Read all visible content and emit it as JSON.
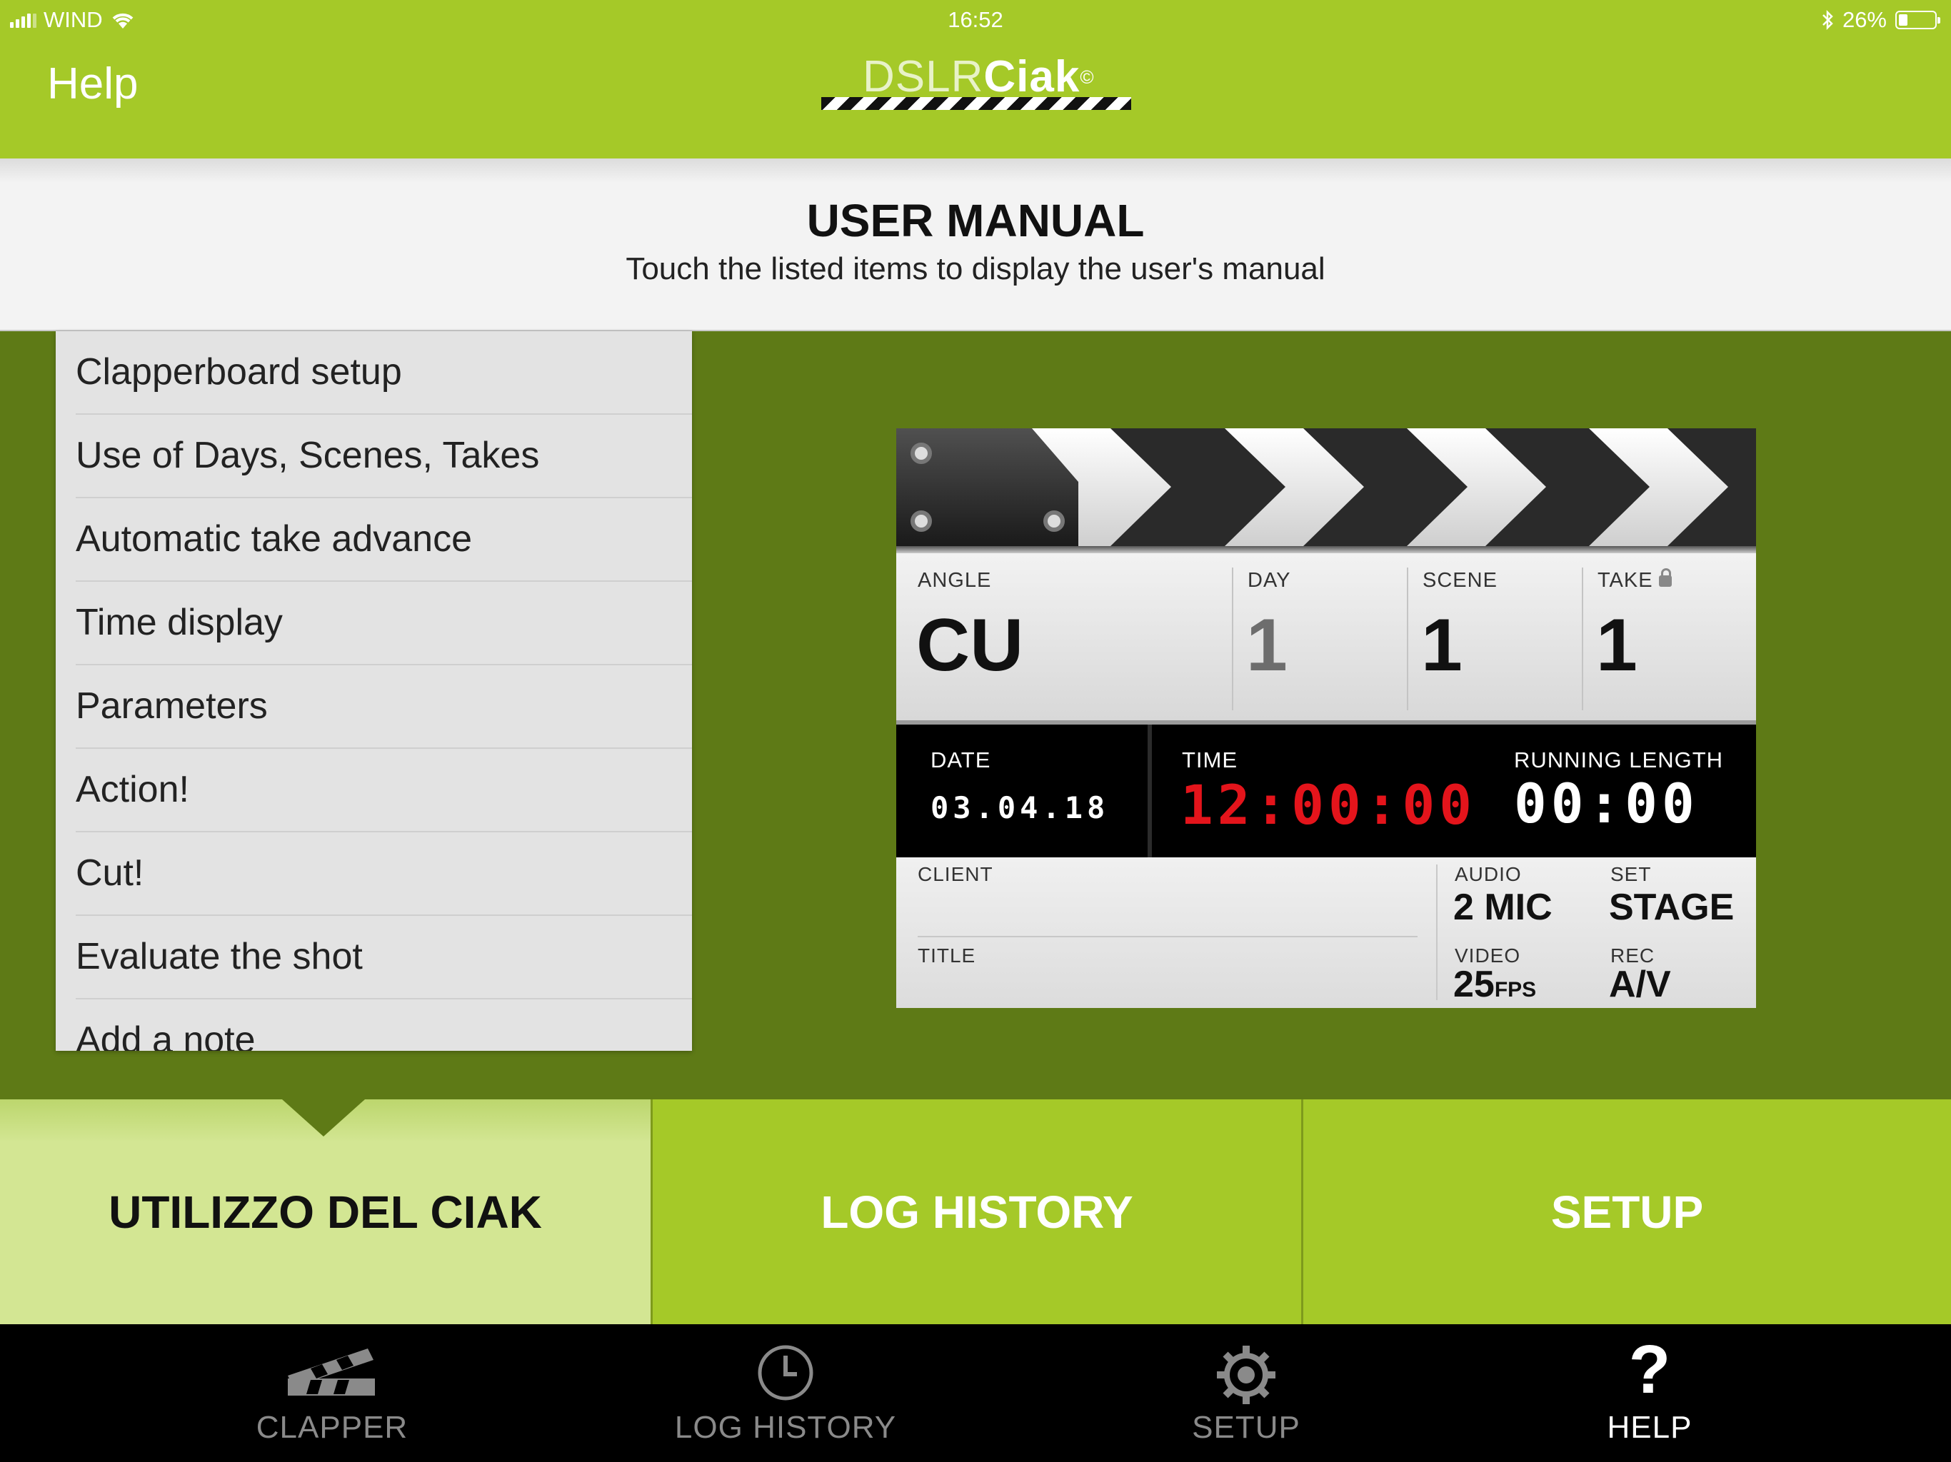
{
  "status_bar": {
    "carrier": "WIND",
    "time": "16:52",
    "battery": "26%",
    "battery_level": 0.26
  },
  "nav": {
    "back_title": "Help",
    "logo": {
      "light": "DSLR",
      "bold": "Ciak",
      "mark": "©"
    }
  },
  "header": {
    "title": "USER MANUAL",
    "subtitle": "Touch the listed items to display the user's manual"
  },
  "manual_items": [
    "Clapperboard setup",
    "Use of Days, Scenes, Takes",
    "Automatic take advance",
    "Time display",
    "Parameters",
    "Action!",
    "Cut!",
    "Evaluate the shot",
    "Add a note"
  ],
  "clapper": {
    "angle_label": "ANGLE",
    "angle_value": "CU",
    "day_label": "DAY",
    "day_value": "1",
    "scene_label": "SCENE",
    "scene_value": "1",
    "take_label": "TAKE",
    "take_value": "1",
    "date_label": "DATE",
    "date_value": "03.04.18",
    "time_label": "TIME",
    "time_value": "12:00:00",
    "running_label": "RUNNING LENGTH",
    "running_value": "00:00",
    "client_label": "CLIENT",
    "title_label": "TITLE",
    "audio_label": "AUDIO",
    "audio_value": "2 MIC",
    "set_label": "SET",
    "set_value": "STAGE",
    "video_label": "VIDEO",
    "video_value": "25",
    "video_unit": "FPS",
    "rec_label": "REC",
    "rec_value": "A/V",
    "colors": {
      "time": "#e4141b",
      "running": "#ffffff",
      "date": "#ffffff"
    }
  },
  "segments": [
    {
      "label": "UTILIZZO DEL CIAK",
      "active": true
    },
    {
      "label": "LOG HISTORY",
      "active": false
    },
    {
      "label": "SETUP",
      "active": false
    }
  ],
  "tabbar": [
    {
      "label": "CLAPPER",
      "icon": "clapper-icon",
      "active": false
    },
    {
      "label": "LOG HISTORY",
      "icon": "clock-icon",
      "active": false
    },
    {
      "label": "SETUP",
      "icon": "gear-icon",
      "active": false
    },
    {
      "label": "HELP",
      "icon": "question-icon",
      "active": true
    }
  ],
  "colors": {
    "accent_green": "#a5c928",
    "dark_green": "#5e7a16",
    "active_segment": "#d3e693"
  }
}
